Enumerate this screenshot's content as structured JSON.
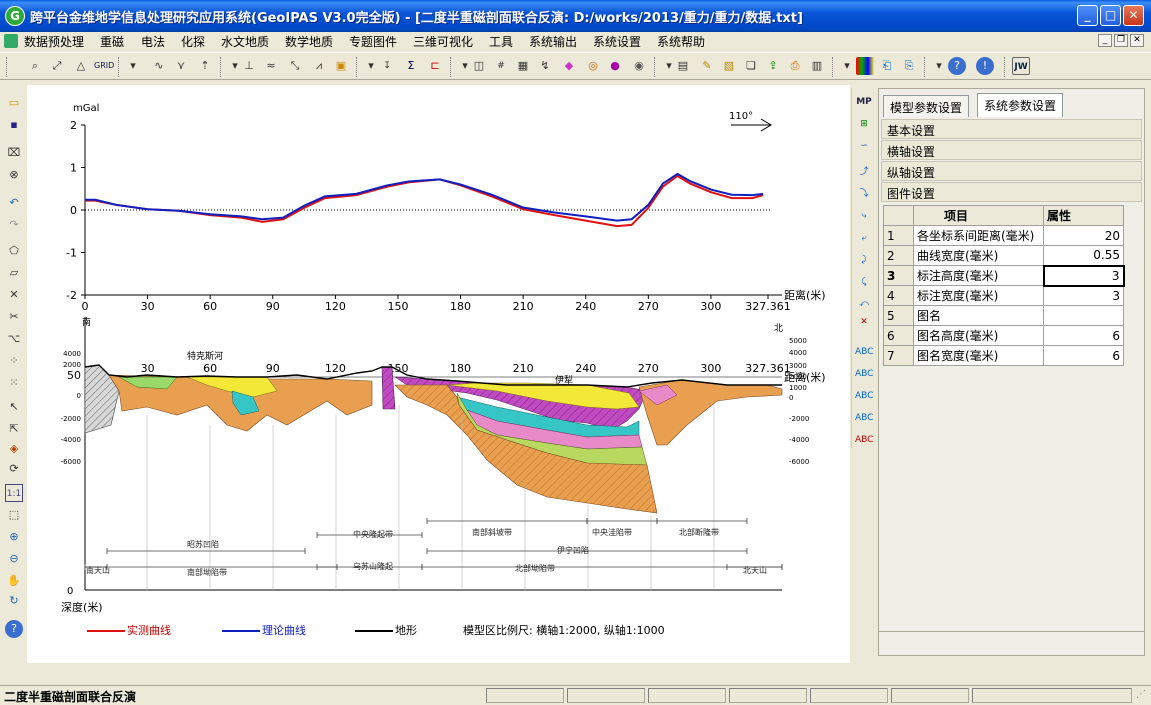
{
  "window": {
    "title": "跨平台金维地学信息处理研究应用系统(GeoIPAS V3.0完全版) - [二度半重磁剖面联合反演: D:/works/2013/重力/重力/数据.txt]",
    "app_icon": "G"
  },
  "menu": [
    "数据预处理",
    "重磁",
    "电法",
    "化探",
    "水文地质",
    "数学地质",
    "专题图件",
    "三维可视化",
    "工具",
    "系统输出",
    "系统设置",
    "系统帮助"
  ],
  "chart_data": [
    {
      "type": "line",
      "ylabel": "mGal",
      "xlabel": "距离(米)",
      "x_ticks": [
        "0",
        "30",
        "60",
        "90",
        "120",
        "150",
        "180",
        "210",
        "240",
        "270",
        "300",
        "327.361"
      ],
      "y_ticks": [
        "2",
        "1",
        "0",
        "-1",
        "-2"
      ],
      "ylim": [
        -2,
        2
      ],
      "xlim": [
        0,
        327.361
      ],
      "direction_label": "110°",
      "series": [
        {
          "name": "实测曲线",
          "color": "#e01010",
          "x": [
            0,
            5,
            15,
            30,
            45,
            60,
            75,
            85,
            95,
            105,
            115,
            130,
            145,
            155,
            170,
            180,
            195,
            210,
            225,
            240,
            255,
            262,
            270,
            277,
            284,
            290,
            300,
            310,
            320,
            325
          ],
          "y": [
            0.22,
            0.22,
            0.12,
            0.02,
            -0.02,
            -0.12,
            -0.18,
            -0.28,
            -0.22,
            0.05,
            0.28,
            0.35,
            0.55,
            0.65,
            0.72,
            0.58,
            0.32,
            0.02,
            -0.12,
            -0.25,
            -0.38,
            -0.35,
            0.05,
            0.55,
            0.8,
            0.62,
            0.42,
            0.28,
            0.28,
            0.35
          ]
        },
        {
          "name": "理论曲线",
          "color": "#1020c0",
          "x": [
            0,
            5,
            15,
            30,
            45,
            60,
            75,
            85,
            95,
            105,
            115,
            130,
            145,
            155,
            170,
            180,
            195,
            210,
            225,
            240,
            255,
            262,
            270,
            277,
            284,
            290,
            300,
            310,
            320,
            325
          ],
          "y": [
            0.24,
            0.24,
            0.12,
            0.02,
            -0.02,
            -0.1,
            -0.15,
            -0.22,
            -0.18,
            0.1,
            0.32,
            0.38,
            0.58,
            0.67,
            0.72,
            0.6,
            0.36,
            0.06,
            -0.06,
            -0.15,
            -0.25,
            -0.22,
            0.12,
            0.62,
            0.85,
            0.68,
            0.48,
            0.36,
            0.35,
            0.38
          ]
        }
      ]
    },
    {
      "type": "area",
      "x_ticks": [
        "30",
        "60",
        "90",
        "120",
        "150",
        "180",
        "210",
        "240",
        "270",
        "300",
        "327.361"
      ],
      "xlabel": "距离(米)",
      "ylabel": "深度(米)",
      "left_ticks": [
        "4000",
        "2000",
        "50",
        "0",
        "-2000",
        "-4000",
        "-6000"
      ],
      "right_ticks": [
        "5000",
        "4000",
        "3000",
        "2000",
        "1000",
        "0",
        "-2000",
        "-4000",
        "-6000"
      ],
      "zero_label": "0",
      "place_labels": [
        "南",
        "北",
        "特克斯河",
        "伊犁"
      ],
      "tectonic_units": [
        "昭苏凹陷",
        "南部坳陷带",
        "中央隆起带",
        "乌苏山隆起",
        "南部斜坡带",
        "中央洼陷带",
        "北部断隆带",
        "伊宁凹陷",
        "北部坳陷带",
        "南天山",
        "北天山"
      ]
    }
  ],
  "legend": [
    {
      "label": "实测曲线",
      "color": "#e01010"
    },
    {
      "label": "理论曲线",
      "color": "#1020c0"
    },
    {
      "label": "地形",
      "color": "#000000"
    }
  ],
  "scale_text": "模型区比例尺: 横轴1:2000, 纵轴1:1000",
  "panel": {
    "tabs": [
      "模型参数设置",
      "系统参数设置"
    ],
    "active_tab": 1,
    "sections": [
      "基本设置",
      "横轴设置",
      "纵轴设置",
      "图件设置"
    ],
    "table_headers": [
      "项目",
      "属性"
    ],
    "rows": [
      {
        "n": "1",
        "key": "各坐标系间距离(毫米)",
        "val": "20"
      },
      {
        "n": "2",
        "key": "曲线宽度(毫米)",
        "val": "0.55"
      },
      {
        "n": "3",
        "key": "标注高度(毫米)",
        "val": "3"
      },
      {
        "n": "4",
        "key": "标注宽度(毫米)",
        "val": "3"
      },
      {
        "n": "5",
        "key": "图名",
        "val": ""
      },
      {
        "n": "6",
        "key": "图名高度(毫米)",
        "val": "6"
      },
      {
        "n": "7",
        "key": "图名宽度(毫米)",
        "val": "6"
      }
    ]
  },
  "status": "二度半重磁剖面联合反演"
}
